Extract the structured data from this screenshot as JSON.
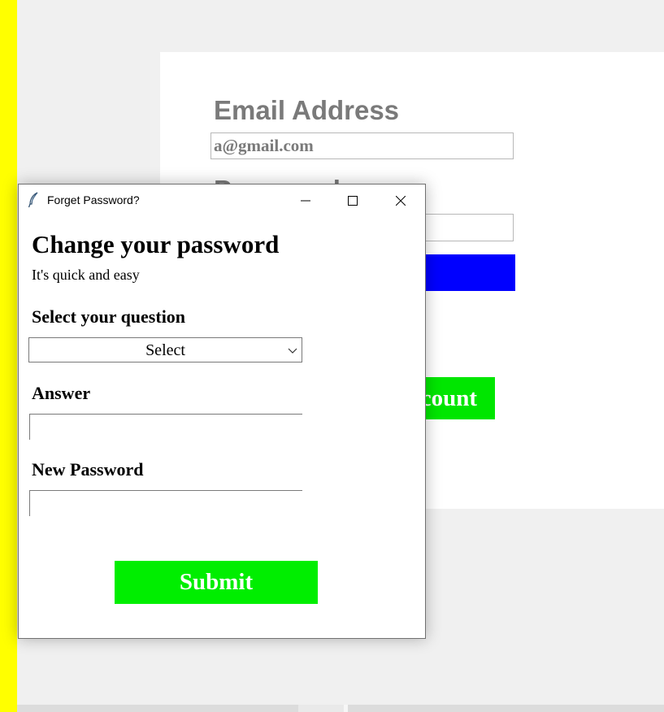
{
  "background_window": {
    "email_label": "Email Address",
    "email_value": "a@gmail.com",
    "password_label": "Password",
    "create_account_partial": "count"
  },
  "dialog": {
    "title": "Forget Password?",
    "heading": "Change your password",
    "subtitle": "It's quick and easy",
    "question_label": "Select your question",
    "question_selected": "Select",
    "answer_label": "Answer",
    "answer_value": "",
    "new_password_label": "New Password",
    "new_password_value": "",
    "submit_label": "Submit"
  },
  "icons": {
    "app": "feather-icon",
    "minimize": "minimize-icon",
    "maximize": "maximize-icon",
    "close": "close-icon",
    "dropdown": "chevron-down-icon"
  },
  "colors": {
    "side_strip": "#ffff00",
    "login_button": "#0000ff",
    "create_account_button": "#00e600",
    "submit_button": "#00ee00",
    "label_gray": "#7a7a7a"
  }
}
